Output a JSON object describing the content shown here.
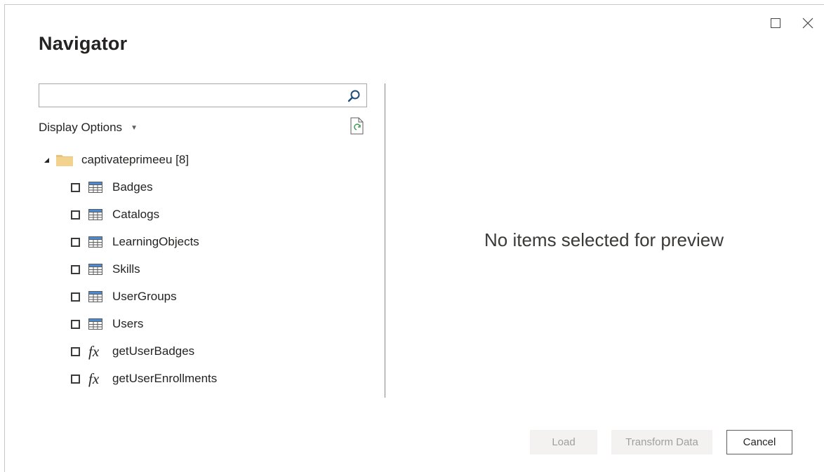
{
  "window": {
    "title": "Navigator",
    "maximize_icon": "maximize-icon",
    "close_icon": "close-icon"
  },
  "search": {
    "value": "",
    "placeholder": "",
    "icon": "search-icon"
  },
  "display_options": {
    "label": "Display Options",
    "caret_icon": "caret-down-icon",
    "refresh_icon": "refresh-icon"
  },
  "tree": {
    "root": {
      "label": "captivateprimeeu [8]",
      "icon": "folder-icon",
      "expanded": true
    },
    "items": [
      {
        "label": "Badges",
        "type": "table",
        "checked": false
      },
      {
        "label": "Catalogs",
        "type": "table",
        "checked": false
      },
      {
        "label": "LearningObjects",
        "type": "table",
        "checked": false
      },
      {
        "label": "Skills",
        "type": "table",
        "checked": false
      },
      {
        "label": "UserGroups",
        "type": "table",
        "checked": false
      },
      {
        "label": "Users",
        "type": "table",
        "checked": false
      },
      {
        "label": "getUserBadges",
        "type": "function",
        "checked": false
      },
      {
        "label": "getUserEnrollments",
        "type": "function",
        "checked": false
      }
    ]
  },
  "preview": {
    "empty_message": "No items selected for preview"
  },
  "footer": {
    "load_label": "Load",
    "transform_label": "Transform Data",
    "cancel_label": "Cancel"
  },
  "colors": {
    "folder": "#e8c37a",
    "table_header": "#4a8ad4",
    "disabled_bg": "#f3f2f1",
    "text": "#252423"
  }
}
